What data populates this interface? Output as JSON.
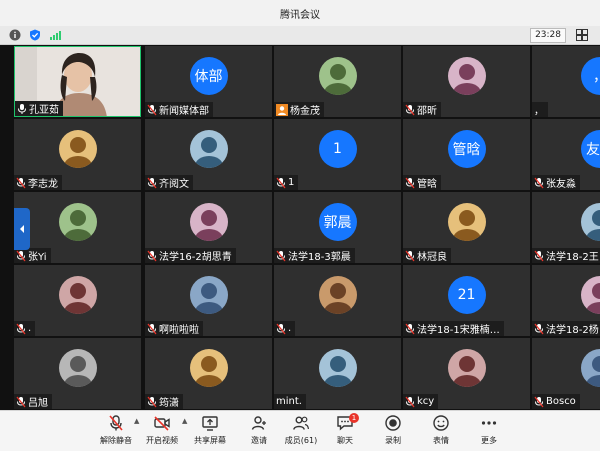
{
  "window": {
    "title": "腾讯会议"
  },
  "status": {
    "time": "23:28"
  },
  "participants": [
    {
      "name": "孔亚茹",
      "avatar_type": "video",
      "mic": "on"
    },
    {
      "name": "新闻媒体部",
      "avatar_type": "blue",
      "avatar_text": "体部",
      "mic": "muted"
    },
    {
      "name": "杨金茂",
      "avatar_type": "photo",
      "mic": "user"
    },
    {
      "name": "邵昕",
      "avatar_type": "photo",
      "mic": "muted"
    },
    {
      "name": "，",
      "avatar_type": "blue",
      "avatar_text": "，",
      "mic": "none"
    },
    {
      "name": "李志龙",
      "avatar_type": "photo",
      "mic": "muted"
    },
    {
      "name": "齐阅文",
      "avatar_type": "photo",
      "mic": "muted"
    },
    {
      "name": "1",
      "avatar_type": "blue",
      "avatar_text": "1",
      "mic": "muted"
    },
    {
      "name": "管晗",
      "avatar_type": "blue",
      "avatar_text": "管晗",
      "mic": "muted"
    },
    {
      "name": "张友淼",
      "avatar_type": "blue",
      "avatar_text": "友淼",
      "mic": "muted"
    },
    {
      "name": "张Yi",
      "avatar_type": "photo",
      "mic": "muted"
    },
    {
      "name": "法学16-2胡思青",
      "avatar_type": "photo",
      "mic": "muted"
    },
    {
      "name": "法学18-3郭晨",
      "avatar_type": "blue",
      "avatar_text": "郭晨",
      "mic": "muted"
    },
    {
      "name": "林冠良",
      "avatar_type": "photo",
      "mic": "muted"
    },
    {
      "name": "法学18-2王",
      "avatar_type": "photo",
      "mic": "muted"
    },
    {
      "name": ".",
      "avatar_type": "photo",
      "mic": "muted"
    },
    {
      "name": "啊啦啦啦",
      "avatar_type": "photo",
      "mic": "muted"
    },
    {
      "name": ".",
      "avatar_type": "photo",
      "mic": "muted"
    },
    {
      "name": "法学18-1宋雅楠…",
      "avatar_type": "blue",
      "avatar_text": "21",
      "mic": "muted"
    },
    {
      "name": "法学18-2杨",
      "avatar_type": "photo",
      "mic": "muted"
    },
    {
      "name": "吕旭",
      "avatar_type": "photo",
      "mic": "muted"
    },
    {
      "name": "筠潇",
      "avatar_type": "photo",
      "mic": "muted"
    },
    {
      "name": "mint.",
      "avatar_type": "photo",
      "mic": "none"
    },
    {
      "name": "kcy",
      "avatar_type": "photo",
      "mic": "muted"
    },
    {
      "name": "Bosco",
      "avatar_type": "photo",
      "mic": "muted"
    }
  ],
  "toolbar": {
    "unmute": "解除静音",
    "start_video": "开启视频",
    "share_screen": "共享屏幕",
    "invite": "邀请",
    "members": "成员(61)",
    "chat": "聊天",
    "chat_badge": "1",
    "record": "录制",
    "reactions": "表情",
    "more": "更多"
  },
  "colors": {
    "accent": "#1677ff",
    "tile_bg": "#2f2f2f",
    "active_border": "#1ec36b",
    "badge": "#e9342a"
  }
}
